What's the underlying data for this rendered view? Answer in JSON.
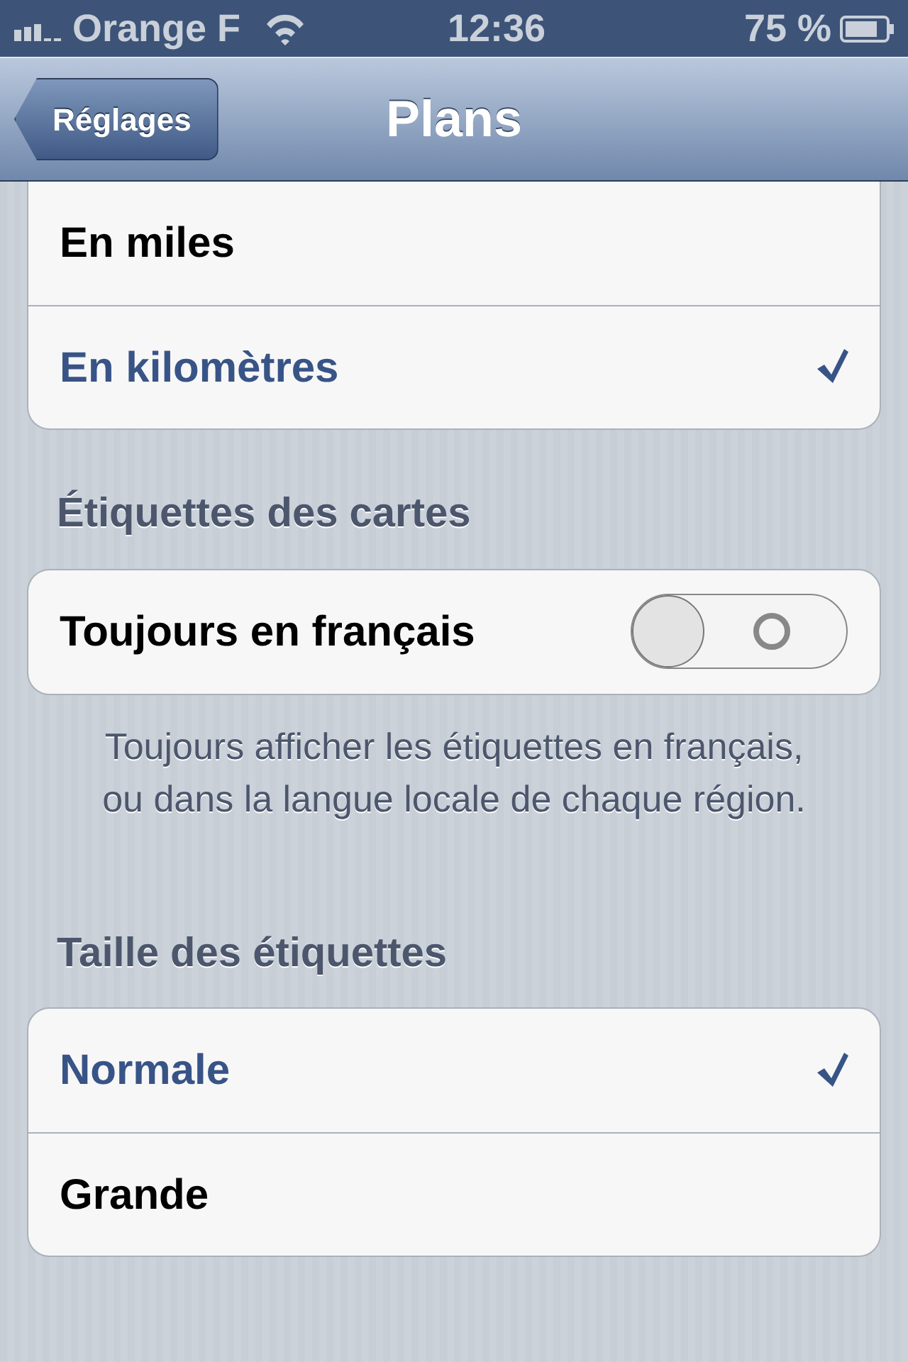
{
  "status_bar": {
    "carrier": "Orange F",
    "time": "12:36",
    "battery": "75 %"
  },
  "nav_bar": {
    "back": "Réglages",
    "title": "Plans"
  },
  "sections": [
    {
      "kind": "choices",
      "items": [
        {
          "label": "En miles",
          "selected": false
        },
        {
          "label": "En kilomètres",
          "selected": true
        }
      ]
    },
    {
      "kind": "toggle",
      "header": "Étiquettes des cartes",
      "items": [
        {
          "label": "Toujours en français",
          "on": false
        }
      ],
      "footer": "Toujours afficher les étiquettes en français, ou dans la langue locale de chaque région."
    },
    {
      "kind": "choices",
      "header": "Taille des étiquettes",
      "items": [
        {
          "label": "Normale",
          "selected": true
        },
        {
          "label": "Grande",
          "selected": false
        }
      ]
    }
  ]
}
